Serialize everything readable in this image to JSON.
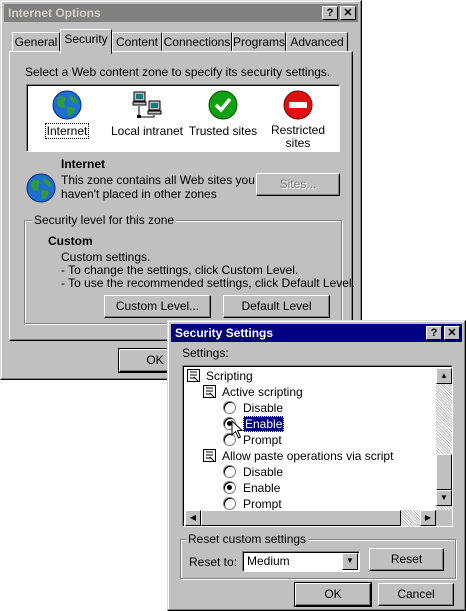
{
  "internet_options": {
    "title": "Internet Options",
    "tabs": [
      "General",
      "Security",
      "Content",
      "Connections",
      "Programs",
      "Advanced"
    ],
    "selected_tab": "Security",
    "zone_prompt": "Select a Web content zone to specify its security settings.",
    "zones": [
      {
        "label": "Internet",
        "icon": "globe-icon"
      },
      {
        "label": "Local intranet",
        "icon": "network-computers-icon"
      },
      {
        "label": "Trusted sites",
        "icon": "check-icon"
      },
      {
        "label": "Restricted sites",
        "icon": "forbidden-icon"
      }
    ],
    "zone_title": "Internet",
    "zone_desc_1": "This zone contains all Web sites you",
    "zone_desc_2": "haven't placed in other zones",
    "sites_button": "Sites...",
    "level_group_label": "Security level for this zone",
    "level_name": "Custom",
    "level_desc_1": "Custom settings.",
    "level_desc_2": "- To change the settings, click Custom Level.",
    "level_desc_3": "- To use the recommended settings, click Default Level.",
    "custom_level_button": "Custom Level...",
    "default_level_button": "Default Level",
    "ok_button": "OK",
    "help_button": "?",
    "close_button": "✕"
  },
  "security_settings": {
    "title": "Security Settings",
    "settings_label": "Settings:",
    "tree": [
      {
        "type": "category",
        "label": "Scripting"
      },
      {
        "type": "setting",
        "label": "Active scripting"
      },
      {
        "type": "option",
        "label": "Disable",
        "selected": false
      },
      {
        "type": "option",
        "label": "Enable",
        "selected": true
      },
      {
        "type": "option",
        "label": "Prompt",
        "selected": false
      },
      {
        "type": "setting",
        "label": "Allow paste operations via script"
      },
      {
        "type": "option",
        "label": "Disable",
        "selected": false
      },
      {
        "type": "option",
        "label": "Enable",
        "selected": true
      },
      {
        "type": "option",
        "label": "Prompt",
        "selected": false
      }
    ],
    "reset_group_label": "Reset custom settings",
    "reset_to_label": "Reset to:",
    "reset_value": "Medium",
    "reset_button": "Reset",
    "ok_button": "OK",
    "cancel_button": "Cancel",
    "help_button": "?",
    "close_button": "✕"
  }
}
